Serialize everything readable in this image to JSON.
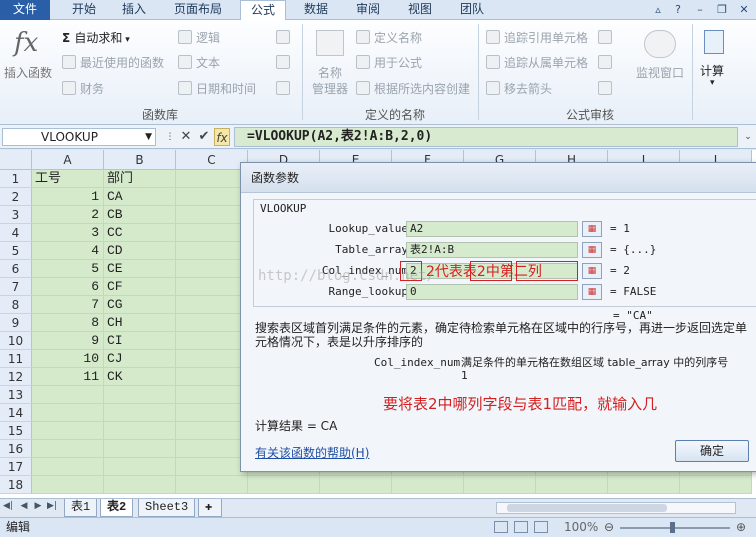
{
  "tabs": [
    "文件",
    "开始",
    "插入",
    "页面布局",
    "公式",
    "数据",
    "审阅",
    "视图",
    "团队"
  ],
  "active_tab": "公式",
  "ribbon": {
    "insert_function": "插入函数",
    "autosum": "自动求和",
    "recent": "最近使用的函数",
    "finance": "财务",
    "logic": "逻辑",
    "text": "文本",
    "datetime": "日期和时间",
    "group_library": "函数库",
    "name_manager_1": "名称",
    "name_manager_2": "管理器",
    "define_name": "定义名称",
    "use_in_formula": "用于公式",
    "create_from_sel": "根据所选内容创建",
    "group_names": "定义的名称",
    "trace_prec": "追踪引用单元格",
    "trace_dep": "追踪从属单元格",
    "remove_arrows": "移去箭头",
    "group_audit": "公式审核",
    "watch": "监视窗口",
    "calc": "计算"
  },
  "formula_bar": {
    "name_box": "VLOOKUP",
    "formula": "=VLOOKUP(A2,表2!A:B,2,0)"
  },
  "columns": [
    "A",
    "B",
    "C",
    "D",
    "E",
    "F",
    "G",
    "H",
    "I",
    "J"
  ],
  "rows": [
    {
      "n": "1",
      "a": "工号",
      "b": "部门"
    },
    {
      "n": "2",
      "a": "1",
      "b": "CA"
    },
    {
      "n": "3",
      "a": "2",
      "b": "CB"
    },
    {
      "n": "4",
      "a": "3",
      "b": "CC"
    },
    {
      "n": "5",
      "a": "4",
      "b": "CD"
    },
    {
      "n": "6",
      "a": "5",
      "b": "CE"
    },
    {
      "n": "7",
      "a": "6",
      "b": "CF"
    },
    {
      "n": "8",
      "a": "7",
      "b": "CG"
    },
    {
      "n": "9",
      "a": "8",
      "b": "CH"
    },
    {
      "n": "10",
      "a": "9",
      "b": "CI"
    },
    {
      "n": "11",
      "a": "10",
      "b": "CJ"
    },
    {
      "n": "12",
      "a": "11",
      "b": "CK"
    },
    {
      "n": "13",
      "a": "",
      "b": ""
    },
    {
      "n": "14",
      "a": "",
      "b": ""
    },
    {
      "n": "15",
      "a": "",
      "b": ""
    },
    {
      "n": "16",
      "a": "",
      "b": ""
    },
    {
      "n": "17",
      "a": "",
      "b": ""
    },
    {
      "n": "18",
      "a": "",
      "b": ""
    }
  ],
  "sheets": [
    "表1",
    "表2",
    "Sheet3"
  ],
  "active_sheet": "表2",
  "status": {
    "mode": "编辑",
    "zoom": "100%"
  },
  "dialog": {
    "title": "函数参数",
    "function": "VLOOKUP",
    "params": [
      {
        "label": "Lookup_value",
        "value": "A2",
        "result": "= 1"
      },
      {
        "label": "Table_array",
        "value": "表2!A:B",
        "result": "= {...}"
      },
      {
        "label": "Col_index_num",
        "value": "2",
        "result": "= 2"
      },
      {
        "label": "Range_lookup",
        "value": "0",
        "result": "= FALSE"
      }
    ],
    "total_result": "= \"CA\"",
    "description": "搜索表区域首列满足条件的元素，确定待检索单元格在区域中的行序号，再进一步返回选定单元格情况下，表是以升序排序的",
    "param_desc_label": "Col_index_num",
    "param_desc_text": "满足条件的单元格在数组区域 table_array 中的列序号",
    "param_desc_text2": "1",
    "calc_result": "计算结果 =  CA",
    "help_link": "有关该函数的帮助(H)",
    "ok": "确定"
  },
  "annotations": {
    "note1": "2代表表2中第二列",
    "note2": "要将表2中哪列字段与表1匹配，就输入几"
  },
  "watermark": "http://blog.csdn.net/"
}
